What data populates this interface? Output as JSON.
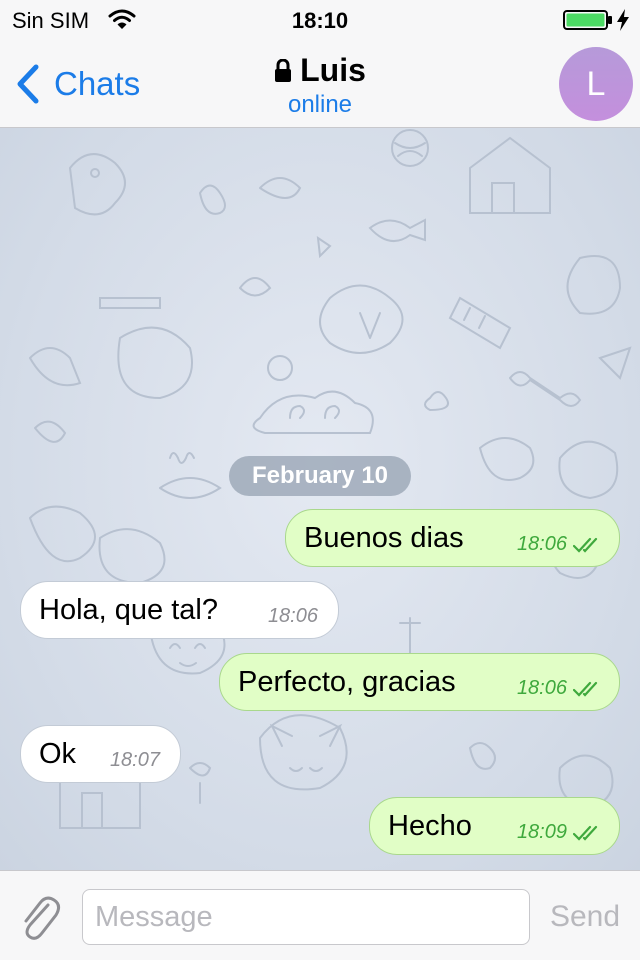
{
  "status_bar": {
    "carrier": "Sin SIM",
    "time": "18:10",
    "wifi_icon": "wifi-icon",
    "battery_icon": "battery-full-icon",
    "battery_color": "#4cd964"
  },
  "header": {
    "back_label": "Chats",
    "title": "Luis",
    "status": "online",
    "avatar_initial": "L",
    "accent_color": "#1b7ce8"
  },
  "chat": {
    "date_divider": "February 10",
    "messages": [
      {
        "direction": "outgoing",
        "text": "Buenos dias",
        "time": "18:06",
        "read": true
      },
      {
        "direction": "incoming",
        "text": "Hola, que tal?",
        "time": "18:06"
      },
      {
        "direction": "outgoing",
        "text": "Perfecto, gracias",
        "time": "18:06",
        "read": true
      },
      {
        "direction": "incoming",
        "text": "Ok",
        "time": "18:07"
      },
      {
        "direction": "outgoing",
        "text": "Hecho",
        "time": "18:09",
        "read": true
      }
    ],
    "outgoing_bubble_color": "#e1fec6",
    "incoming_bubble_color": "#ffffff"
  },
  "composer": {
    "placeholder": "Message",
    "value": "",
    "send_label": "Send",
    "attach_icon": "paperclip-icon"
  }
}
